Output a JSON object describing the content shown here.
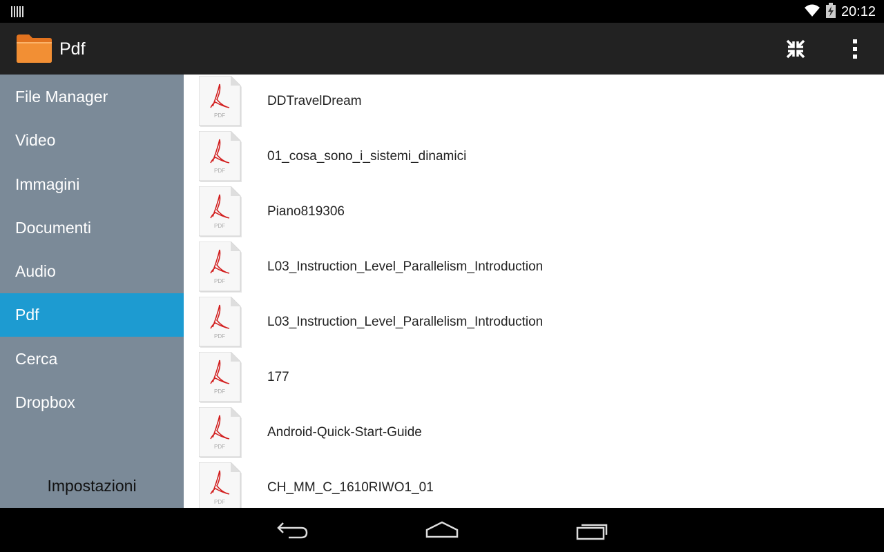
{
  "status_bar": {
    "time": "20:12"
  },
  "action_bar": {
    "title": "Pdf"
  },
  "sidebar": {
    "items": [
      {
        "label": "File Manager",
        "active": false
      },
      {
        "label": "Video",
        "active": false
      },
      {
        "label": "Immagini",
        "active": false
      },
      {
        "label": "Documenti",
        "active": false
      },
      {
        "label": "Audio",
        "active": false
      },
      {
        "label": "Pdf",
        "active": true
      },
      {
        "label": "Cerca",
        "active": false
      },
      {
        "label": "Dropbox",
        "active": false
      }
    ],
    "settings_label": "Impostazioni"
  },
  "files": [
    {
      "name": "DDTravelDream",
      "icon_label": "PDF"
    },
    {
      "name": "01_cosa_sono_i_sistemi_dinamici",
      "icon_label": "PDF"
    },
    {
      "name": "Piano819306",
      "icon_label": "PDF"
    },
    {
      "name": "L03_Instruction_Level_Parallelism_Introduction",
      "icon_label": "PDF"
    },
    {
      "name": "L03_Instruction_Level_Parallelism_Introduction",
      "icon_label": "PDF"
    },
    {
      "name": "177",
      "icon_label": "PDF"
    },
    {
      "name": "Android-Quick-Start-Guide",
      "icon_label": "PDF"
    },
    {
      "name": "CH_MM_C_1610RIWO1_01",
      "icon_label": "PDF"
    }
  ],
  "colors": {
    "sidebar_bg": "#7b8a98",
    "sidebar_active": "#1d9bd1",
    "action_bar_bg": "#222222",
    "pdf_red": "#d21f1f"
  }
}
